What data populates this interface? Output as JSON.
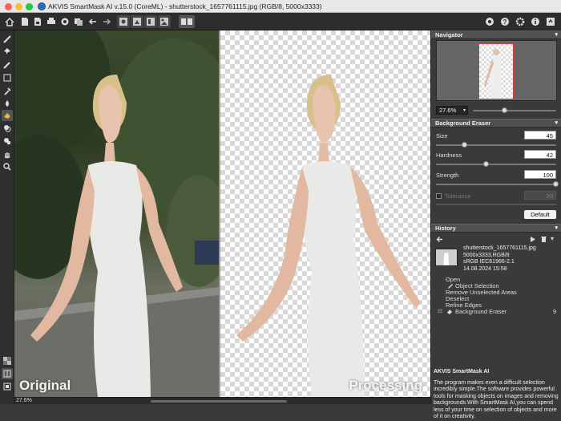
{
  "window": {
    "title": "AKVIS SmartMask AI v.15.0 (CoreML) - shutterstock_1657761115.jpg (RGB/8, 5000x3333)",
    "traffic_colors": [
      "#fe5f57",
      "#febc2e",
      "#28c840"
    ]
  },
  "toolbar": {
    "left_icons": [
      "home-icon",
      "open-file-icon",
      "save-file-icon",
      "print-icon",
      "share-icon",
      "batch-icon",
      "undo-icon",
      "redo-icon",
      "auto-select-icon",
      "mask-icon",
      "background-icon",
      "replace-icon",
      "view-mode-icon"
    ],
    "right_icons": [
      "settings-wheel-icon",
      "help-icon",
      "preferences-icon",
      "info-icon",
      "collapse-icon"
    ]
  },
  "left_tools": [
    "selection-brush-icon",
    "magic-pin-icon",
    "eraser-brush-icon",
    "rectangle-icon",
    "dropper-icon",
    "drop-icon",
    "background-eraser-icon",
    "clone-icon",
    "chameleon-icon",
    "hand-icon",
    "zoom-icon"
  ],
  "canvas": {
    "left_label": "Original",
    "right_label": "Processing"
  },
  "status": {
    "zoom": "27.6%"
  },
  "navigator": {
    "header": "Navigator",
    "zoom": "27.6%",
    "zoom_fraction": 0.38
  },
  "background_eraser": {
    "header": "Background Eraser",
    "size_label": "Size",
    "size_value": "45",
    "size_fraction": 0.24,
    "hardness_label": "Hardness",
    "hardness_value": "42",
    "hardness_fraction": 0.42,
    "strength_label": "Strength",
    "strength_value": "100",
    "strength_fraction": 1.0,
    "tolerance_label": "Tolerance",
    "tolerance_value": "20",
    "default_label": "Default"
  },
  "history": {
    "header": "History",
    "file_info": [
      "shutterstock_1657761115.jpg",
      "5000x3333,RGB/8",
      "sRGB IEC61966-2.1",
      "14.08.2024 15:58"
    ],
    "items": [
      {
        "label": "Open",
        "icon": ""
      },
      {
        "label": "Object Selection",
        "icon": "selection-icon"
      },
      {
        "label": "Remove Unselected Areas",
        "icon": ""
      },
      {
        "label": "Deselect",
        "icon": ""
      },
      {
        "label": "Refine Edges",
        "icon": ""
      },
      {
        "label": "Background Eraser",
        "icon": "background-eraser-icon",
        "count": "9"
      }
    ]
  },
  "about": {
    "title": "AKVIS SmartMask AI",
    "text": "The program makes even a difficult selection incredibly simple.The software provides powerful tools for masking objects on images and removing backgrounds.With SmartMask AI,you can spend less of your time on selection of objects and more of it on creativity."
  }
}
